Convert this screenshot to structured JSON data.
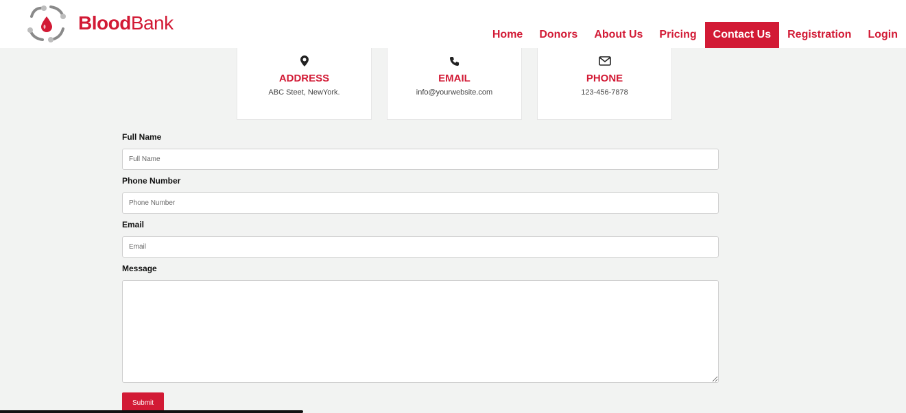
{
  "brand": {
    "bold": "Blood",
    "light": "Bank",
    "accent": "#d21a35"
  },
  "nav": {
    "items": [
      {
        "label": "Home"
      },
      {
        "label": "Donors"
      },
      {
        "label": "About Us"
      },
      {
        "label": "Pricing"
      },
      {
        "label": "Contact Us",
        "active": true
      },
      {
        "label": "Registration"
      },
      {
        "label": "Login"
      }
    ]
  },
  "contact_cards": [
    {
      "icon": "map-pin-icon",
      "title": "ADDRESS",
      "value": "ABC Steet, NewYork."
    },
    {
      "icon": "phone-icon",
      "title": "EMAIL",
      "value": "info@yourwebsite.com"
    },
    {
      "icon": "envelope-icon",
      "title": "PHONE",
      "value": "123-456-7878"
    }
  ],
  "form": {
    "full_name": {
      "label": "Full Name",
      "placeholder": "Full Name",
      "value": ""
    },
    "phone": {
      "label": "Phone Number",
      "placeholder": "Phone Number",
      "value": ""
    },
    "email": {
      "label": "Email",
      "placeholder": "Email",
      "value": ""
    },
    "message": {
      "label": "Message",
      "value": ""
    },
    "submit_label": "Submit"
  }
}
